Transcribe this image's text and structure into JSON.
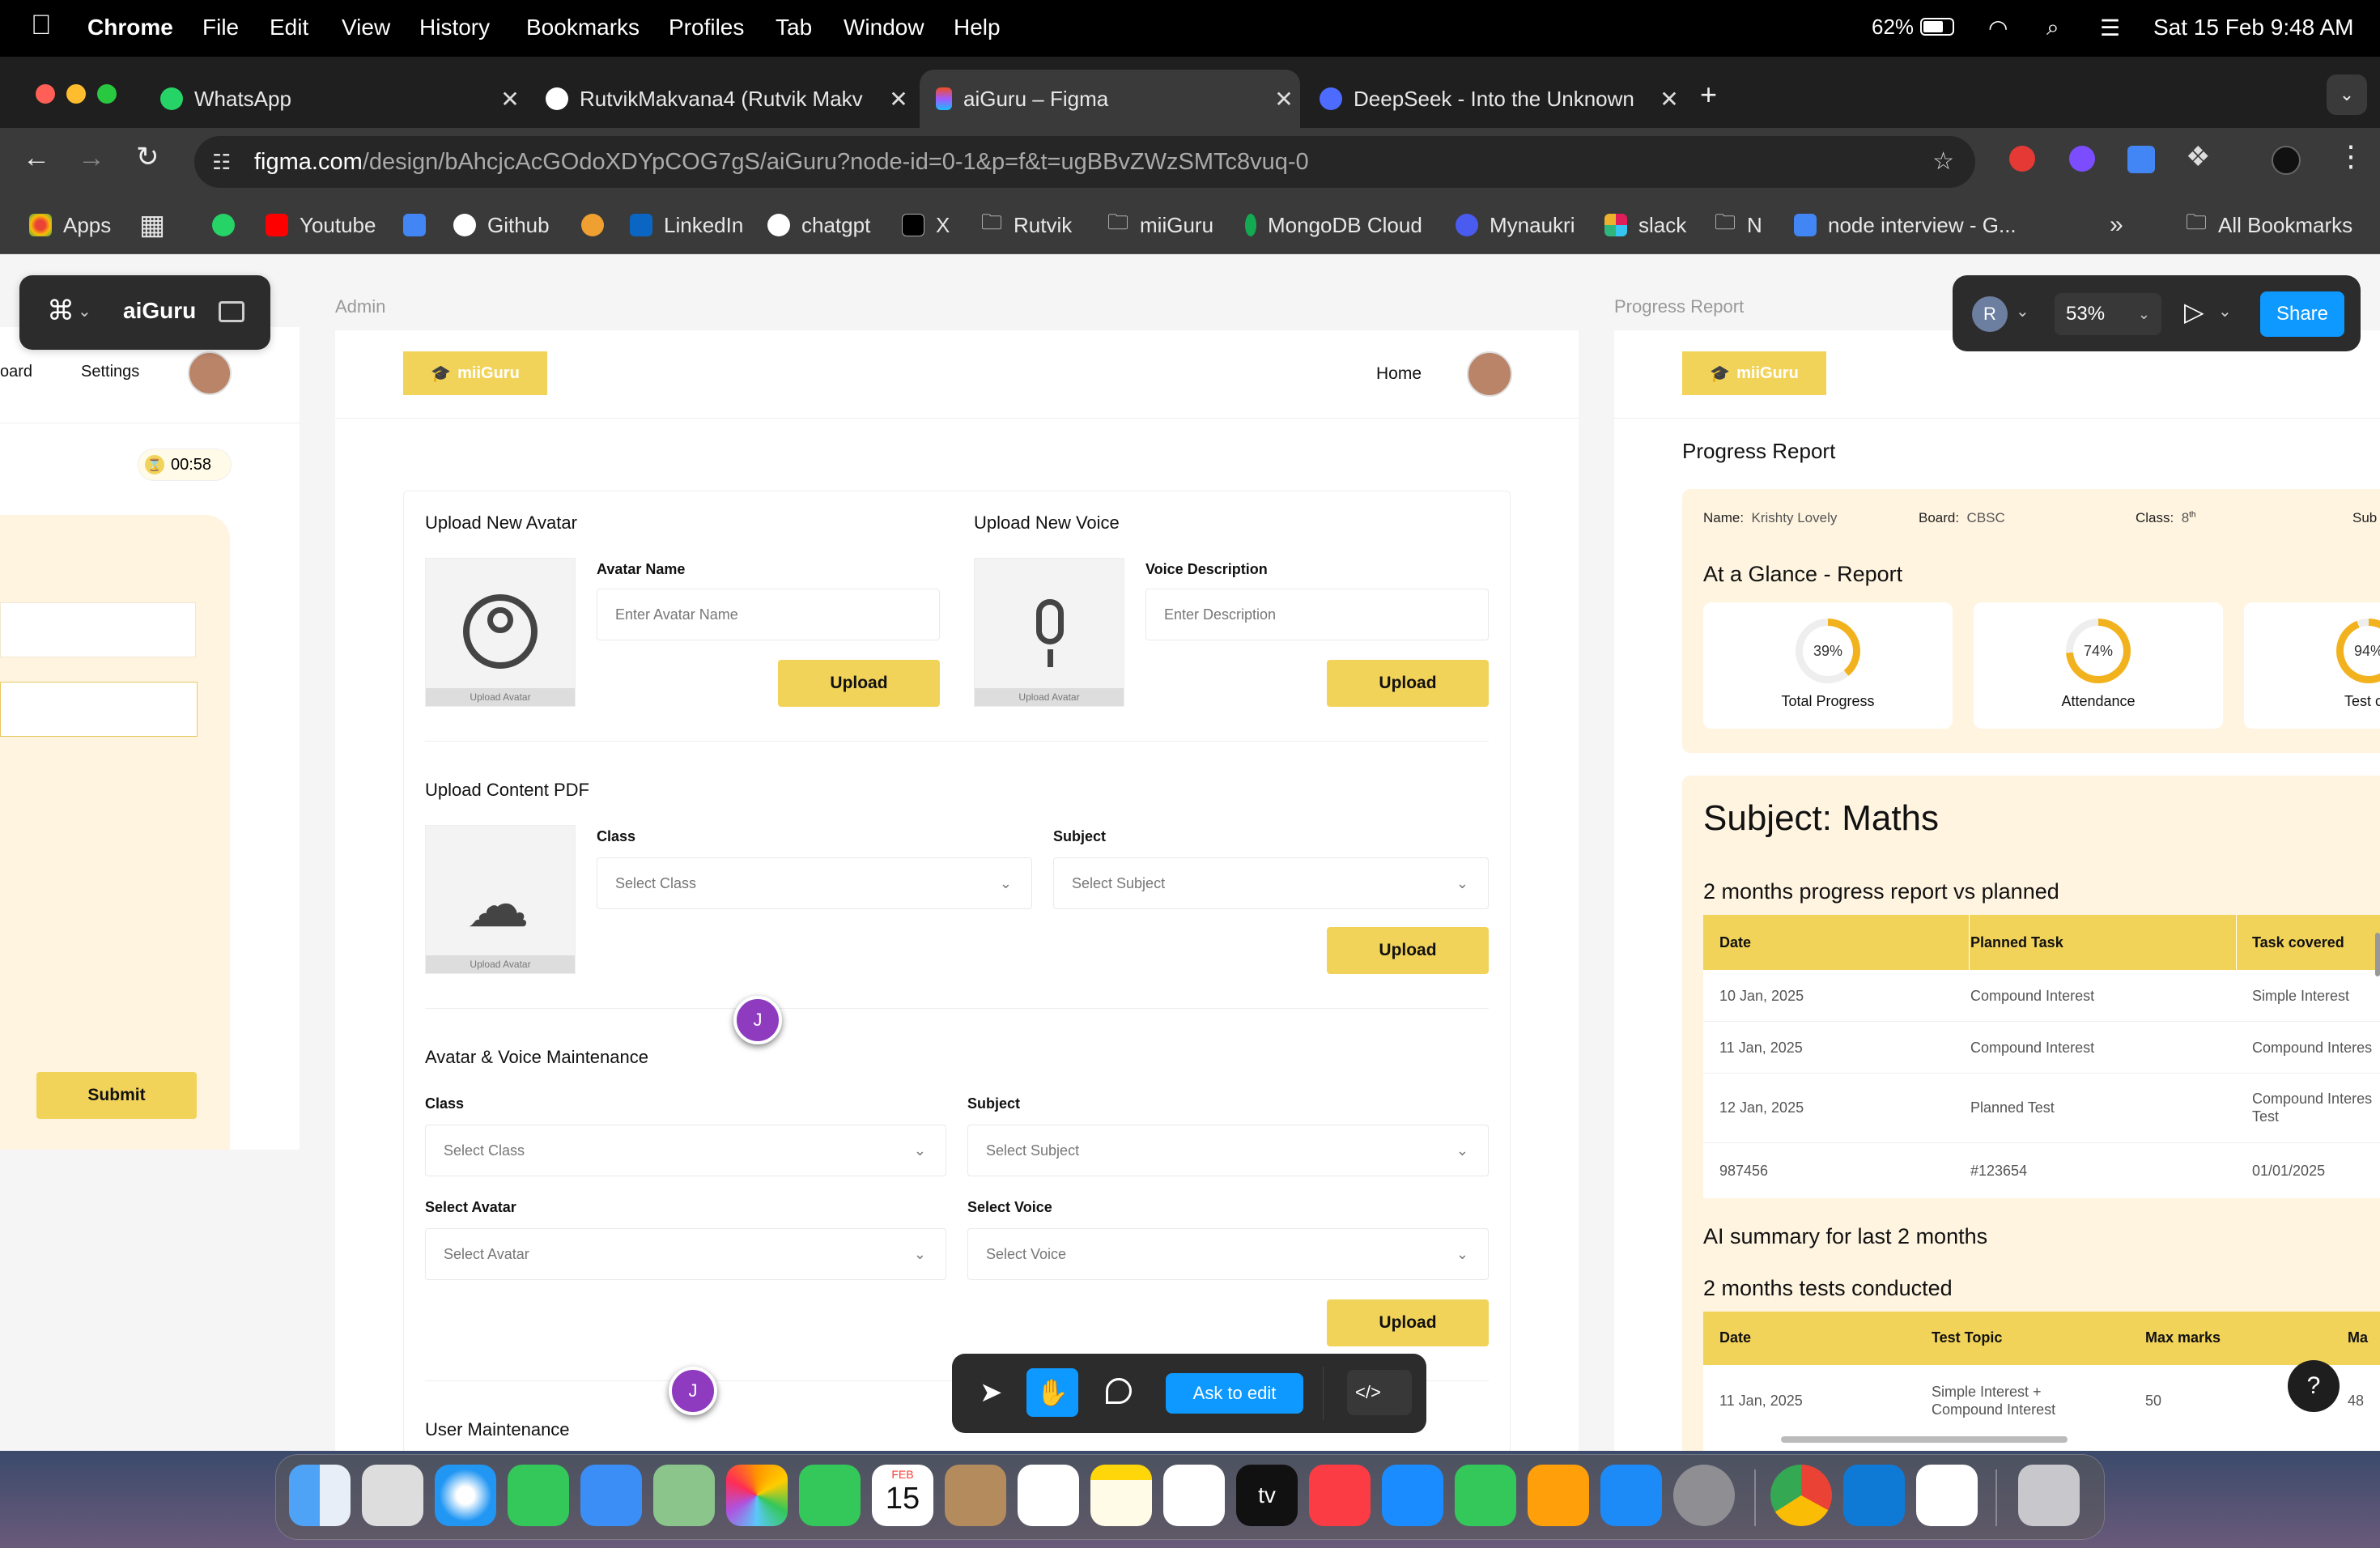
{
  "menubar": {
    "app": "Chrome",
    "items": [
      "File",
      "Edit",
      "View",
      "History",
      "Bookmarks",
      "Profiles",
      "Tab",
      "Window",
      "Help"
    ],
    "battery": "62%",
    "datetime": "Sat 15 Feb  9:48 AM"
  },
  "tabs": [
    {
      "title": "WhatsApp"
    },
    {
      "title": "RutvikMakvana4 (Rutvik Makv"
    },
    {
      "title": "aiGuru – Figma"
    },
    {
      "title": "DeepSeek - Into the Unknown"
    }
  ],
  "address": {
    "domain": "figma.com",
    "path": "/design/bAhcjcAcGOdoXDYpCOG7gS/aiGuru?node-id=0-1&p=f&t=ugBBvZWzSMTc8vuq-0"
  },
  "bookmarks": [
    "Apps",
    "Youtube",
    "Github",
    "LinkedIn",
    "chatgpt",
    "X",
    "Rutvik",
    "miiGuru",
    "MongoDB Cloud",
    "Mynaukri",
    "slack",
    "N",
    "node interview - G...",
    "All Bookmarks"
  ],
  "figma": {
    "file_name": "aiGuru",
    "avatar_initial": "R",
    "zoom": "53%",
    "share": "Share",
    "frame_admin": "Admin",
    "frame_progress": "Progress Report",
    "cursor_initial": "J",
    "toolbar_ask": "Ask to edit",
    "help": "?"
  },
  "left_frame": {
    "nav_board": "oard",
    "nav_settings": "Settings",
    "timer": "00:58",
    "submit": "Submit"
  },
  "admin": {
    "logo": "miiGuru",
    "home": "Home",
    "avatar_section": {
      "title": "Upload New Avatar",
      "label": "Avatar Name",
      "placeholder": "Enter Avatar Name",
      "caption": "Upload Avatar",
      "button": "Upload"
    },
    "voice_section": {
      "title": "Upload New Voice",
      "label": "Voice Description",
      "placeholder": "Enter Description",
      "caption": "Upload Avatar",
      "button": "Upload"
    },
    "pdf_section": {
      "title": "Upload Content PDF",
      "class_label": "Class",
      "class_placeholder": "Select Class",
      "subject_label": "Subject",
      "subject_placeholder": "Select Subject",
      "caption": "Upload Avatar",
      "button": "Upload"
    },
    "maint_section": {
      "title": "Avatar & Voice Maintenance",
      "class_label": "Class",
      "class_placeholder": "Select Class",
      "subject_label": "Subject",
      "subject_placeholder": "Select Subject",
      "avatar_label": "Select Avatar",
      "avatar_placeholder": "Select Avatar",
      "voice_label": "Select Voice",
      "voice_placeholder": "Select Voice",
      "button": "Upload"
    },
    "user_section": {
      "title": "User Maintenance"
    }
  },
  "progress": {
    "logo": "miiGuru",
    "title": "Progress Report",
    "info": {
      "name_label": "Name:",
      "name": "Krishty Lovely",
      "board_label": "Board:",
      "board": "CBSC",
      "class_label": "Class:",
      "class": "8",
      "class_sup": "th",
      "sub": "Sub"
    },
    "glance_title": "At a Glance - Report",
    "stats": [
      {
        "value": "39%",
        "label": "Total Progress"
      },
      {
        "value": "74%",
        "label": "Attendance"
      },
      {
        "value": "94%",
        "label": "Test c"
      }
    ],
    "subject": "Subject: Maths",
    "table1_title": "2 months progress report vs planned",
    "table1_headers": [
      "Date",
      "Planned Task",
      "Task covered"
    ],
    "table1_rows": [
      [
        "10 Jan, 2025",
        "Compound Interest",
        "Simple Interest"
      ],
      [
        "11 Jan, 2025",
        "Compound Interest",
        "Compound Interes"
      ],
      [
        "12 Jan, 2025",
        "Planned Test",
        "Compound Interes\nTest"
      ],
      [
        "987456",
        "#123654",
        "01/01/2025"
      ]
    ],
    "ai_summary": "AI summary for last 2 months",
    "table2_title": "2 months tests conducted",
    "table2_headers": [
      "Date",
      "Test Topic",
      "Max marks",
      "Ma"
    ],
    "table2_rows": [
      [
        "11 Jan, 2025",
        "Simple Interest +\nCompound Interest",
        "50",
        "48"
      ]
    ]
  },
  "dock": {
    "calendar_month": "FEB",
    "calendar_day": "15",
    "tv": "tv"
  }
}
